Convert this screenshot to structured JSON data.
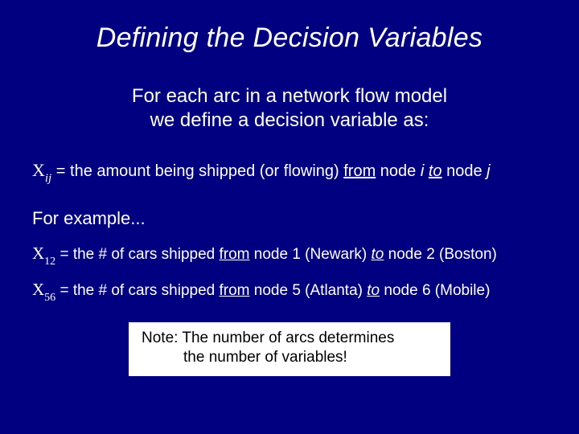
{
  "title": "Defining the Decision Variables",
  "intro_line1": "For each arc in a network flow model",
  "intro_line2": "we define a decision variable as:",
  "def": {
    "var": "X",
    "sub": "ij",
    "eq": " = ",
    "pre": "the amount being shipped (or flowing) ",
    "from": "from",
    "mid1": " node ",
    "i": "i",
    "sp": "  ",
    "to": "to",
    "mid2": " node ",
    "j": "j"
  },
  "example_lead": "For example...",
  "ex1": {
    "var": "X",
    "sub": "12",
    "eq": " = ",
    "pre": "the # of cars shipped ",
    "from": "from",
    "mid1": " node 1 (Newark) ",
    "to": "to",
    "mid2": " node 2 (Boston)"
  },
  "ex2": {
    "var": "X",
    "sub": "56",
    "eq": " = ",
    "pre": "the # of cars shipped ",
    "from": "from",
    "mid1": " node 5 (Atlanta) ",
    "to": "to",
    "mid2": " node 6 (Mobile)"
  },
  "note_line1": "Note: The number of arcs determines",
  "note_line2": "the number of variables!"
}
